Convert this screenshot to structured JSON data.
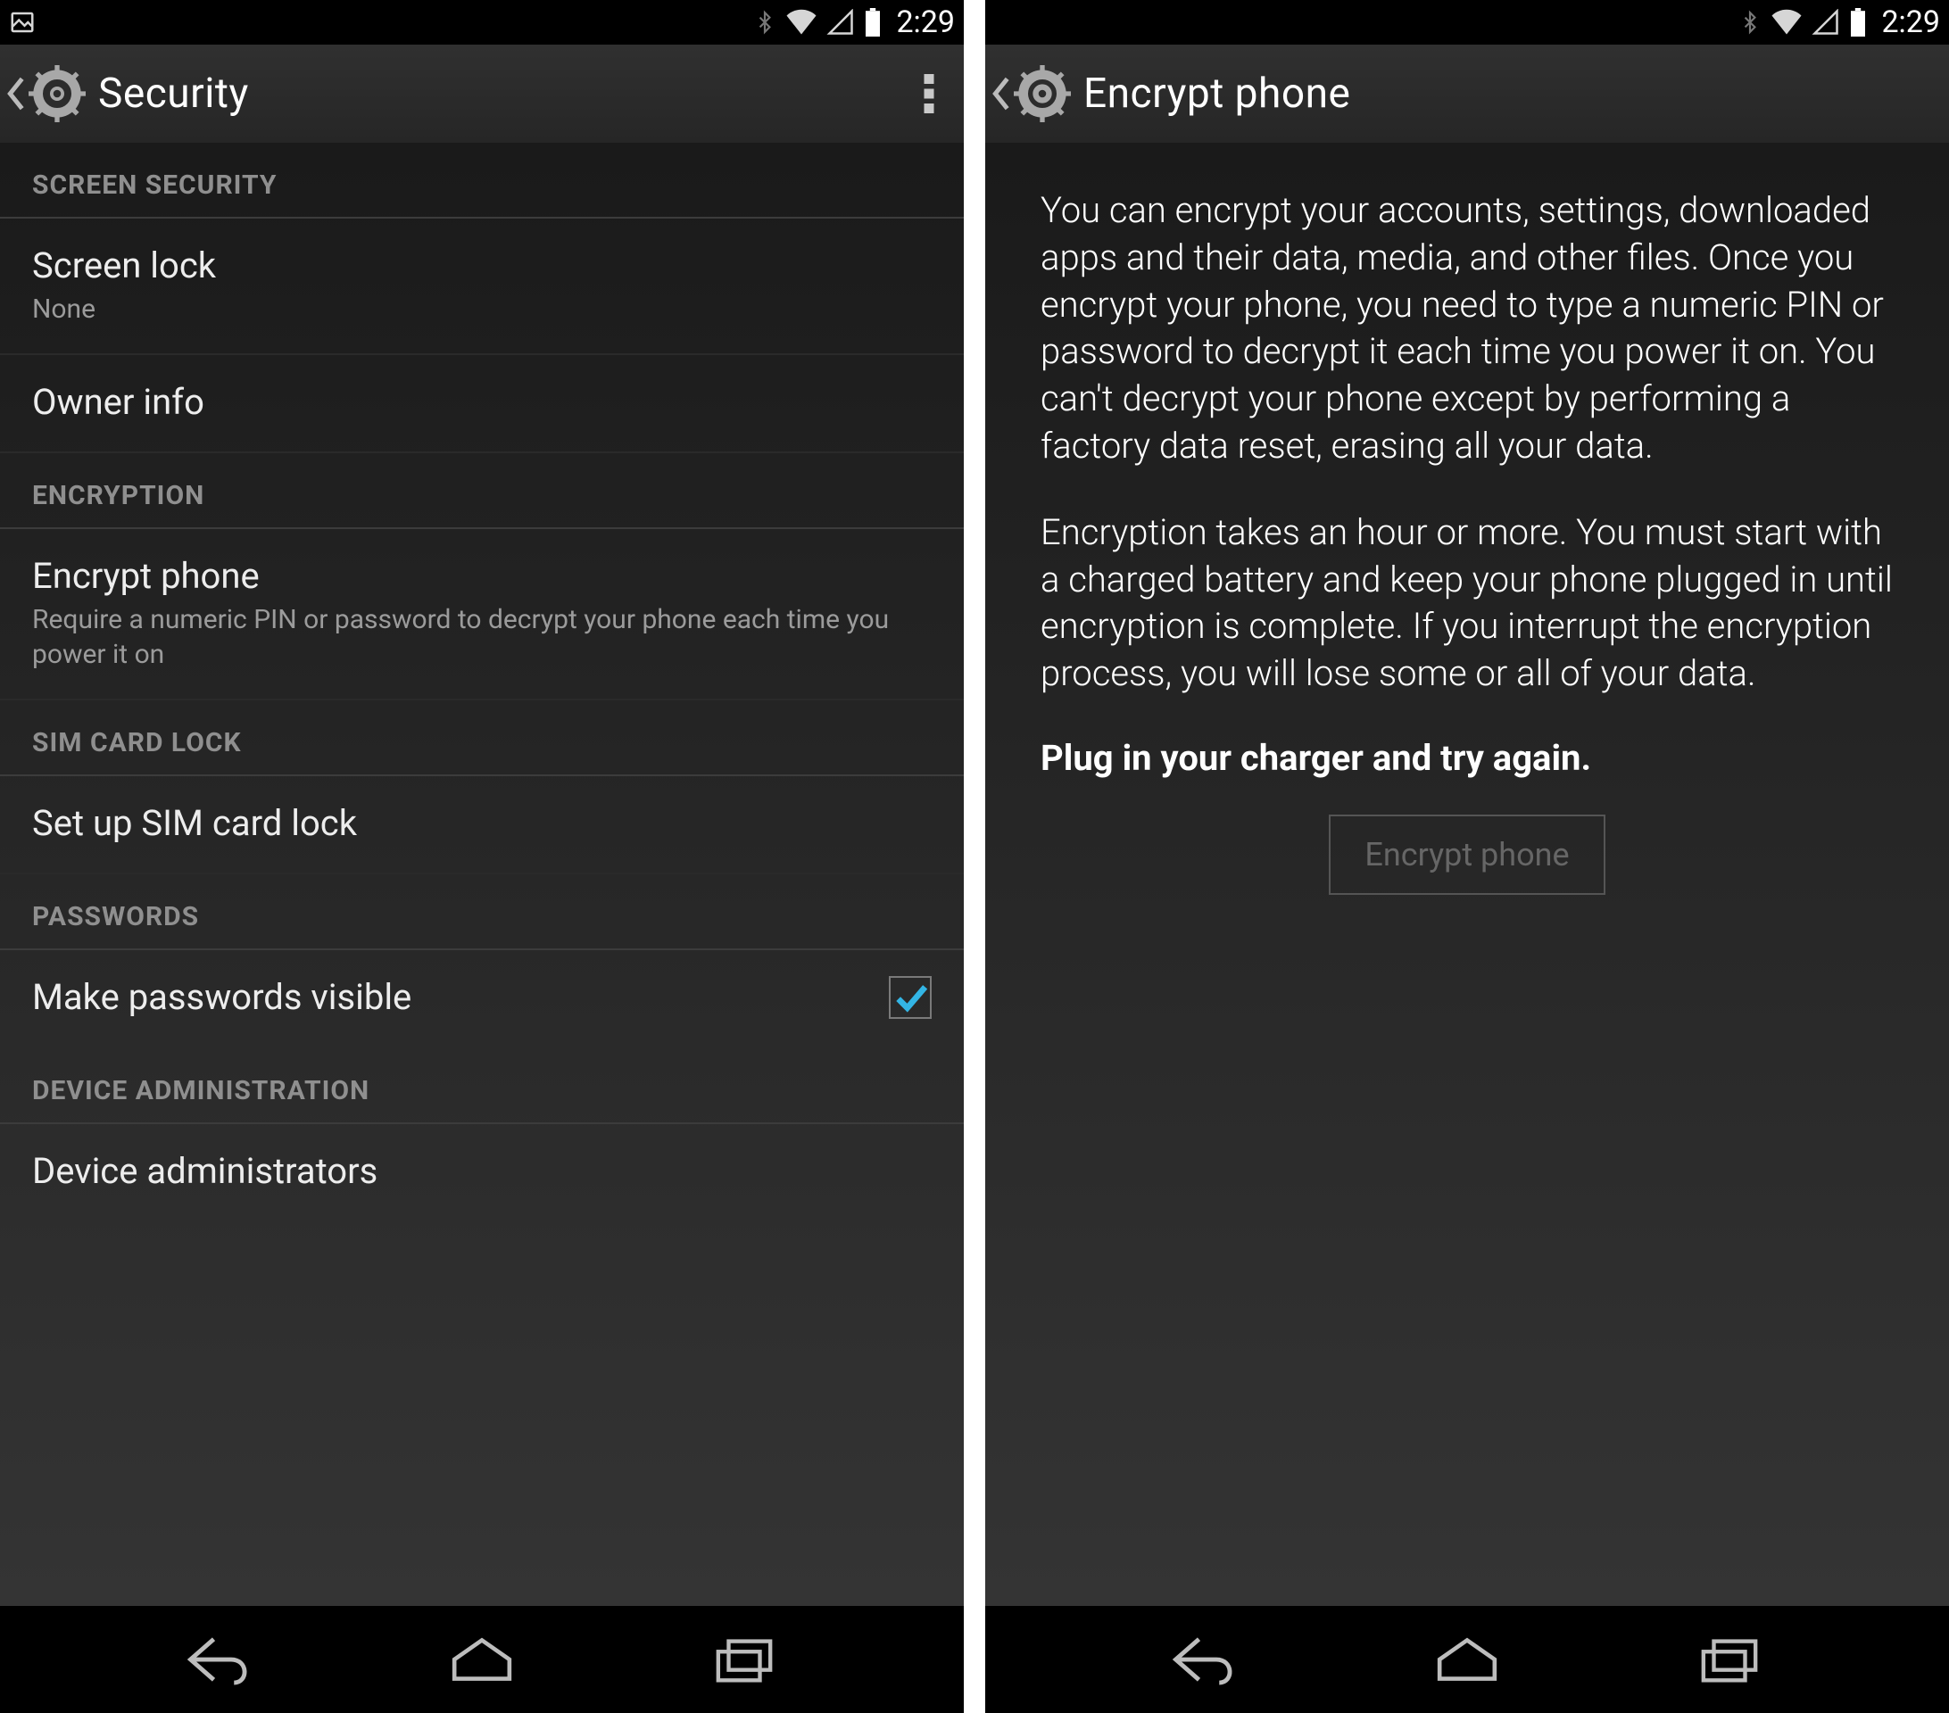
{
  "status_bar": {
    "time": "2:29"
  },
  "left": {
    "title": "Security",
    "sections": [
      {
        "header": "SCREEN SECURITY",
        "items": [
          {
            "title": "Screen lock",
            "sub": "None"
          },
          {
            "title": "Owner info"
          }
        ]
      },
      {
        "header": "ENCRYPTION",
        "items": [
          {
            "title": "Encrypt phone",
            "sub": "Require a numeric PIN or password to decrypt your phone each time you power it on"
          }
        ]
      },
      {
        "header": "SIM CARD LOCK",
        "items": [
          {
            "title": "Set up SIM card lock"
          }
        ]
      },
      {
        "header": "PASSWORDS",
        "items": [
          {
            "title": "Make passwords visible",
            "checkbox": true,
            "checked": true
          }
        ]
      },
      {
        "header": "DEVICE ADMINISTRATION",
        "items": [
          {
            "title": "Device administrators"
          }
        ]
      }
    ]
  },
  "right": {
    "title": "Encrypt phone",
    "paragraph1": "You can encrypt your accounts, settings, downloaded apps and their data, media, and other files. Once you encrypt your phone, you need to type a numeric PIN or password to decrypt it each time you power it on. You can't decrypt your phone except by performing a factory data reset, erasing all your data.",
    "paragraph2": "Encryption takes an hour or more. You must start with a charged battery and keep your phone plugged in until encryption is complete. If you interrupt the encryption process, you will lose some or all of your data.",
    "warning": "Plug in your charger and try again.",
    "button": "Encrypt phone",
    "button_enabled": false
  }
}
